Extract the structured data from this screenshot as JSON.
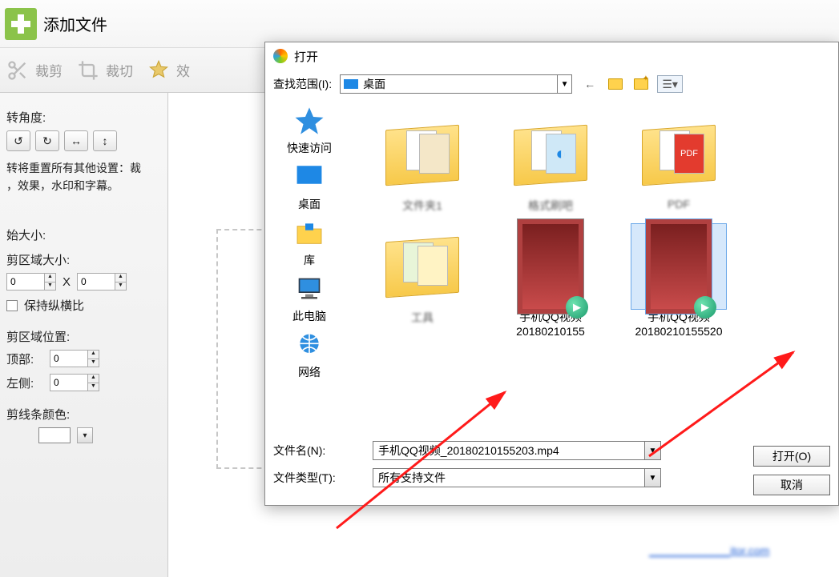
{
  "header": {
    "add_file": "添加文件"
  },
  "toolbar": {
    "crop": "裁剪",
    "cut": "裁切",
    "effect": "效"
  },
  "left": {
    "rotate_label": "转角度:",
    "rotate_hint": "转将重置所有其他设置：裁\n，效果，水印和字幕。",
    "orig_size": "始大小:",
    "crop_size": "剪区域大小:",
    "x_sep": "X",
    "keep_ratio": "保持纵横比",
    "crop_pos": "剪区域位置:",
    "top": "顶部:",
    "left": "左侧:",
    "line_color": "剪线条颜色:",
    "zero": "0"
  },
  "watermark_url": "_____________itor.com",
  "dialog": {
    "title": "打开",
    "look_in_label": "查找范围(I):",
    "look_in_value": "桌面",
    "places": {
      "quick": "快速访问",
      "desktop": "桌面",
      "lib": "库",
      "pc": "此电脑",
      "net": "网络"
    },
    "folders": [
      {
        "name": "文件夹1"
      },
      {
        "name": "格式刷吧"
      },
      {
        "name": "PDF"
      },
      {
        "name": "工具"
      }
    ],
    "videos": [
      {
        "line1": "手机QQ视频",
        "line2": "20180210155"
      },
      {
        "line1": "手机QQ视频",
        "line2": "20180210155520"
      }
    ],
    "filename_label": "文件名(N):",
    "filename_value": "手机QQ视频_20180210155203.mp4",
    "filetype_label": "文件类型(T):",
    "filetype_value": "所有支持文件",
    "open_btn": "打开(O)",
    "cancel_btn": "取消"
  }
}
